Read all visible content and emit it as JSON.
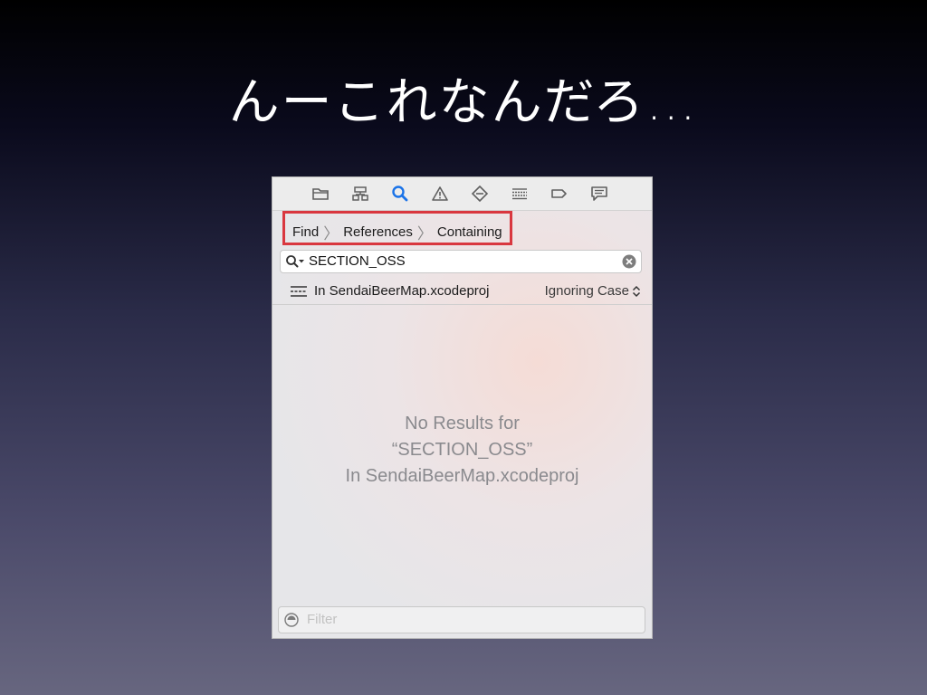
{
  "slide": {
    "title": "んーこれなんだろ…"
  },
  "navigator": {
    "tabs": [
      {
        "icon": "folder-icon"
      },
      {
        "icon": "hierarchy-icon"
      },
      {
        "icon": "search-icon",
        "active": true
      },
      {
        "icon": "warning-icon"
      },
      {
        "icon": "test-diamond-icon"
      },
      {
        "icon": "debug-list-icon"
      },
      {
        "icon": "breakpoint-icon"
      },
      {
        "icon": "report-bubble-icon"
      }
    ],
    "active_color": "#1a73e8"
  },
  "find": {
    "breadcrumb": [
      "Find",
      "References",
      "Containing"
    ],
    "search_value": "SECTION_OSS",
    "scope_label": "In SendaiBeerMap.xcodeproj",
    "case_option": "Ignoring Case",
    "highlight_color": "#d9373f"
  },
  "results": {
    "line1": "No Results for",
    "line2": "“SECTION_OSS”",
    "line3": "In SendaiBeerMap.xcodeproj"
  },
  "filter": {
    "placeholder": "Filter"
  }
}
